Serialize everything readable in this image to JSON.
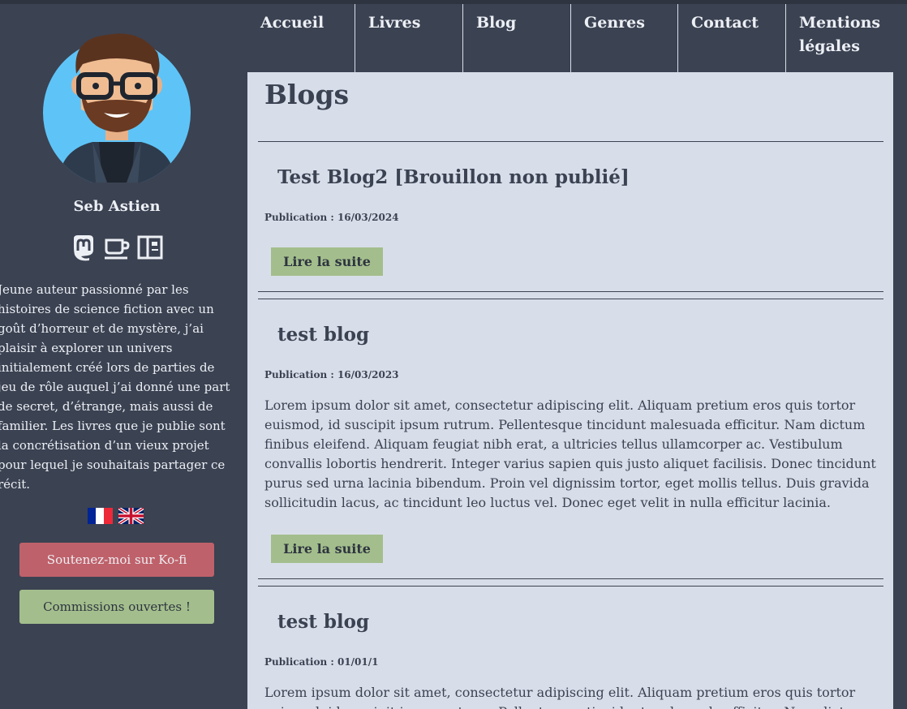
{
  "author": {
    "name": "Seb Astien",
    "bio": "Jeune auteur passionné par les histoires de science fiction avec un goût d’horreur et de mystère, j’ai plaisir à explorer un univers initialement créé lors de parties de jeu de rôle auquel j’ai donné une part de secret, d’étrange, mais aussi de familier. Les livres que je publie sont la concrétisation d’un vieux projet pour lequel je souhaitais partager ce récit."
  },
  "socials": [
    "mastodon-icon",
    "kofi-cup-icon",
    "blog-layout-icon"
  ],
  "languages": [
    "fr-flag-icon",
    "uk-flag-icon"
  ],
  "sidebar_buttons": {
    "kofi": "Soutenez-moi sur Ko-fi",
    "commissions": "Commissions ouvertes !"
  },
  "nav": {
    "items": [
      {
        "label": "Accueil"
      },
      {
        "label": "Livres"
      },
      {
        "label": "Blog"
      },
      {
        "label": "Genres"
      },
      {
        "label": "Contact"
      },
      {
        "label": "Mentions légales"
      }
    ]
  },
  "main": {
    "title": "Blogs",
    "posts": [
      {
        "title": "Test Blog2 [Brouillon non publié]",
        "date": "Publication : 16/03/2024",
        "excerpt": "",
        "read_more": "Lire la suite"
      },
      {
        "title": "test blog",
        "date": "Publication : 16/03/2023",
        "excerpt": "Lorem ipsum dolor sit amet, consectetur adipiscing elit. Aliquam pretium eros quis tortor euismod, id suscipit ipsum rutrum. Pellentesque tincidunt malesuada efficitur. Nam dictum finibus eleifend. Aliquam feugiat nibh erat, a ultricies tellus ullamcorper ac. Vestibulum convallis lobortis hendrerit. Integer varius sapien quis justo aliquet facilisis. Donec tincidunt purus sed urna lacinia bibendum. Proin vel dignissim tortor, eget mollis tellus. Duis gravida sollicitudin lacus, ac tincidunt leo luctus vel. Donec eget velit in nulla efficitur lacinia.",
        "read_more": "Lire la suite"
      },
      {
        "title": "test blog",
        "date": "Publication : 01/01/1",
        "excerpt": "Lorem ipsum dolor sit amet, consectetur adipiscing elit. Aliquam pretium eros quis tortor euismod, id suscipit ipsum rutrum. Pellentesque tincidunt malesuada efficitur. Nam dictum finibus eleifend.",
        "read_more": "Lire la suite"
      }
    ]
  },
  "colors": {
    "background": "#3b4252",
    "content": "#d8dee9",
    "text_light": "#eceff4",
    "text_dark": "#3b4252",
    "accent_red": "#bf616a",
    "accent_green": "#a3be8c",
    "avatar_bg": "#5ec4f7"
  }
}
